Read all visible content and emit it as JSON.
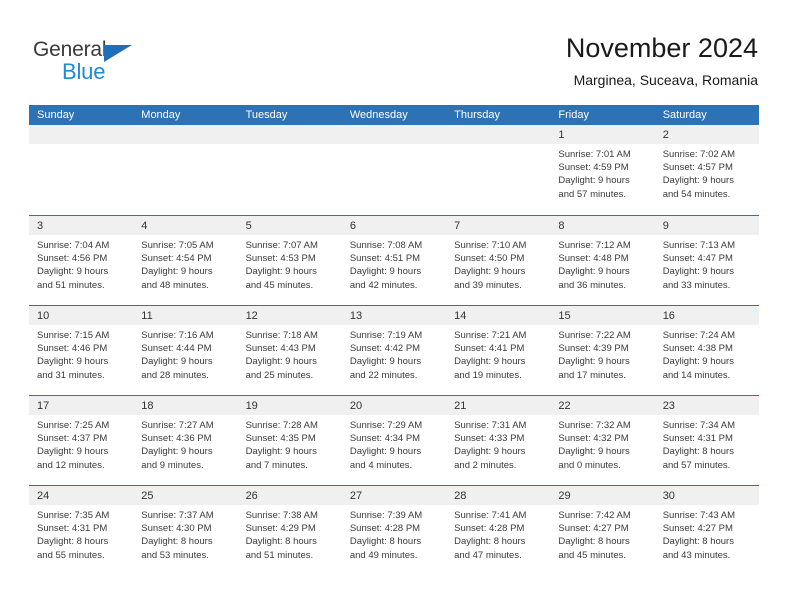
{
  "brand": {
    "word1": "General",
    "word2": "Blue",
    "triangle_color": "#1f6fba",
    "blue_color": "#1f8ad6"
  },
  "header": {
    "title": "November 2024",
    "subtitle": "Marginea, Suceava, Romania"
  },
  "theme": {
    "header_bar_color": "#2d72b5",
    "day_band_color": "#f0f0f0",
    "row_divider_color": "#2d72b5",
    "text_color": "#3b3b3b"
  },
  "weekdays": [
    "Sunday",
    "Monday",
    "Tuesday",
    "Wednesday",
    "Thursday",
    "Friday",
    "Saturday"
  ],
  "weeks": [
    [
      {
        "day": "",
        "lines": []
      },
      {
        "day": "",
        "lines": []
      },
      {
        "day": "",
        "lines": []
      },
      {
        "day": "",
        "lines": []
      },
      {
        "day": "",
        "lines": []
      },
      {
        "day": "1",
        "lines": [
          "Sunrise: 7:01 AM",
          "Sunset: 4:59 PM",
          "Daylight: 9 hours",
          "and 57 minutes."
        ]
      },
      {
        "day": "2",
        "lines": [
          "Sunrise: 7:02 AM",
          "Sunset: 4:57 PM",
          "Daylight: 9 hours",
          "and 54 minutes."
        ]
      }
    ],
    [
      {
        "day": "3",
        "lines": [
          "Sunrise: 7:04 AM",
          "Sunset: 4:56 PM",
          "Daylight: 9 hours",
          "and 51 minutes."
        ]
      },
      {
        "day": "4",
        "lines": [
          "Sunrise: 7:05 AM",
          "Sunset: 4:54 PM",
          "Daylight: 9 hours",
          "and 48 minutes."
        ]
      },
      {
        "day": "5",
        "lines": [
          "Sunrise: 7:07 AM",
          "Sunset: 4:53 PM",
          "Daylight: 9 hours",
          "and 45 minutes."
        ]
      },
      {
        "day": "6",
        "lines": [
          "Sunrise: 7:08 AM",
          "Sunset: 4:51 PM",
          "Daylight: 9 hours",
          "and 42 minutes."
        ]
      },
      {
        "day": "7",
        "lines": [
          "Sunrise: 7:10 AM",
          "Sunset: 4:50 PM",
          "Daylight: 9 hours",
          "and 39 minutes."
        ]
      },
      {
        "day": "8",
        "lines": [
          "Sunrise: 7:12 AM",
          "Sunset: 4:48 PM",
          "Daylight: 9 hours",
          "and 36 minutes."
        ]
      },
      {
        "day": "9",
        "lines": [
          "Sunrise: 7:13 AM",
          "Sunset: 4:47 PM",
          "Daylight: 9 hours",
          "and 33 minutes."
        ]
      }
    ],
    [
      {
        "day": "10",
        "lines": [
          "Sunrise: 7:15 AM",
          "Sunset: 4:46 PM",
          "Daylight: 9 hours",
          "and 31 minutes."
        ]
      },
      {
        "day": "11",
        "lines": [
          "Sunrise: 7:16 AM",
          "Sunset: 4:44 PM",
          "Daylight: 9 hours",
          "and 28 minutes."
        ]
      },
      {
        "day": "12",
        "lines": [
          "Sunrise: 7:18 AM",
          "Sunset: 4:43 PM",
          "Daylight: 9 hours",
          "and 25 minutes."
        ]
      },
      {
        "day": "13",
        "lines": [
          "Sunrise: 7:19 AM",
          "Sunset: 4:42 PM",
          "Daylight: 9 hours",
          "and 22 minutes."
        ]
      },
      {
        "day": "14",
        "lines": [
          "Sunrise: 7:21 AM",
          "Sunset: 4:41 PM",
          "Daylight: 9 hours",
          "and 19 minutes."
        ]
      },
      {
        "day": "15",
        "lines": [
          "Sunrise: 7:22 AM",
          "Sunset: 4:39 PM",
          "Daylight: 9 hours",
          "and 17 minutes."
        ]
      },
      {
        "day": "16",
        "lines": [
          "Sunrise: 7:24 AM",
          "Sunset: 4:38 PM",
          "Daylight: 9 hours",
          "and 14 minutes."
        ]
      }
    ],
    [
      {
        "day": "17",
        "lines": [
          "Sunrise: 7:25 AM",
          "Sunset: 4:37 PM",
          "Daylight: 9 hours",
          "and 12 minutes."
        ]
      },
      {
        "day": "18",
        "lines": [
          "Sunrise: 7:27 AM",
          "Sunset: 4:36 PM",
          "Daylight: 9 hours",
          "and 9 minutes."
        ]
      },
      {
        "day": "19",
        "lines": [
          "Sunrise: 7:28 AM",
          "Sunset: 4:35 PM",
          "Daylight: 9 hours",
          "and 7 minutes."
        ]
      },
      {
        "day": "20",
        "lines": [
          "Sunrise: 7:29 AM",
          "Sunset: 4:34 PM",
          "Daylight: 9 hours",
          "and 4 minutes."
        ]
      },
      {
        "day": "21",
        "lines": [
          "Sunrise: 7:31 AM",
          "Sunset: 4:33 PM",
          "Daylight: 9 hours",
          "and 2 minutes."
        ]
      },
      {
        "day": "22",
        "lines": [
          "Sunrise: 7:32 AM",
          "Sunset: 4:32 PM",
          "Daylight: 9 hours",
          "and 0 minutes."
        ]
      },
      {
        "day": "23",
        "lines": [
          "Sunrise: 7:34 AM",
          "Sunset: 4:31 PM",
          "Daylight: 8 hours",
          "and 57 minutes."
        ]
      }
    ],
    [
      {
        "day": "24",
        "lines": [
          "Sunrise: 7:35 AM",
          "Sunset: 4:31 PM",
          "Daylight: 8 hours",
          "and 55 minutes."
        ]
      },
      {
        "day": "25",
        "lines": [
          "Sunrise: 7:37 AM",
          "Sunset: 4:30 PM",
          "Daylight: 8 hours",
          "and 53 minutes."
        ]
      },
      {
        "day": "26",
        "lines": [
          "Sunrise: 7:38 AM",
          "Sunset: 4:29 PM",
          "Daylight: 8 hours",
          "and 51 minutes."
        ]
      },
      {
        "day": "27",
        "lines": [
          "Sunrise: 7:39 AM",
          "Sunset: 4:28 PM",
          "Daylight: 8 hours",
          "and 49 minutes."
        ]
      },
      {
        "day": "28",
        "lines": [
          "Sunrise: 7:41 AM",
          "Sunset: 4:28 PM",
          "Daylight: 8 hours",
          "and 47 minutes."
        ]
      },
      {
        "day": "29",
        "lines": [
          "Sunrise: 7:42 AM",
          "Sunset: 4:27 PM",
          "Daylight: 8 hours",
          "and 45 minutes."
        ]
      },
      {
        "day": "30",
        "lines": [
          "Sunrise: 7:43 AM",
          "Sunset: 4:27 PM",
          "Daylight: 8 hours",
          "and 43 minutes."
        ]
      }
    ]
  ]
}
